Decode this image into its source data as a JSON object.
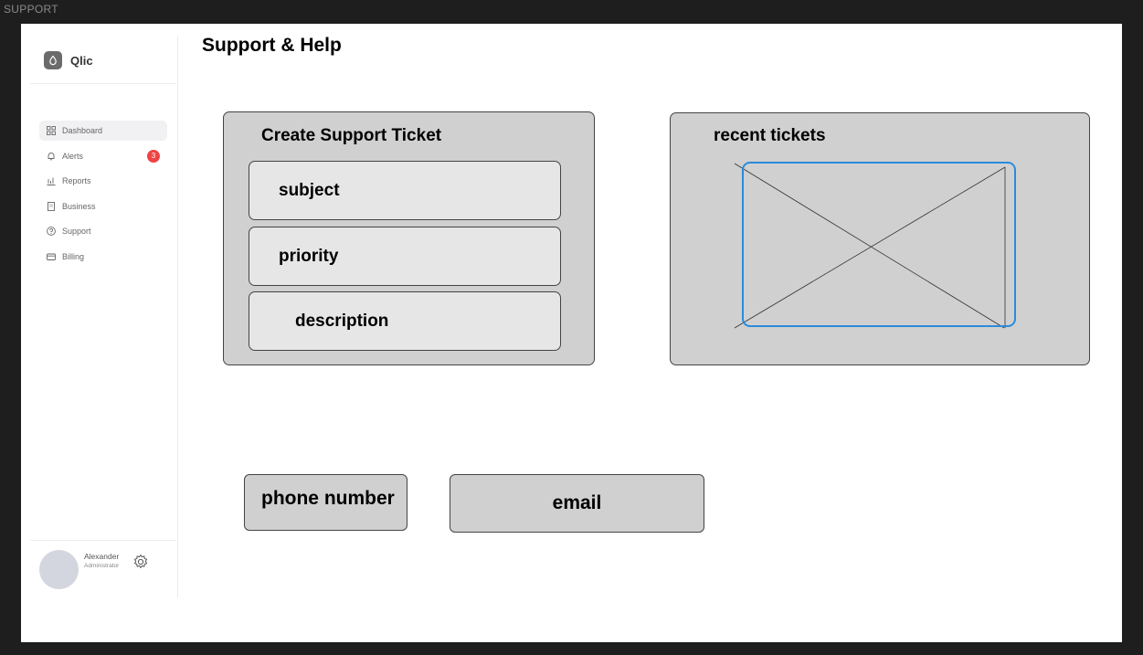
{
  "frame_label": "SUPPORT",
  "sidebar": {
    "brand": "Qlic",
    "items": [
      {
        "label": "Dashboard",
        "icon": "grid-icon",
        "active": true
      },
      {
        "label": "Alerts",
        "icon": "bell-icon",
        "badge": "3"
      },
      {
        "label": "Reports",
        "icon": "bar-chart-icon"
      },
      {
        "label": "Business",
        "icon": "building-icon"
      },
      {
        "label": "Support",
        "icon": "help-circle-icon"
      },
      {
        "label": "Billing",
        "icon": "credit-card-icon"
      }
    ],
    "user": {
      "name": "Alexander",
      "role": "Administrator"
    }
  },
  "main": {
    "title": "Support & Help",
    "ticket_form": {
      "title": "Create Support Ticket",
      "fields": {
        "subject": "subject",
        "priority": "priority",
        "description": "description"
      }
    },
    "recent": {
      "title": "recent tickets"
    },
    "contact": {
      "phone": "phone number",
      "email": "email"
    }
  },
  "colors": {
    "placeholder_border": "#2a8bdc",
    "badge": "#ef4444",
    "panel": "#d0d0d0"
  }
}
